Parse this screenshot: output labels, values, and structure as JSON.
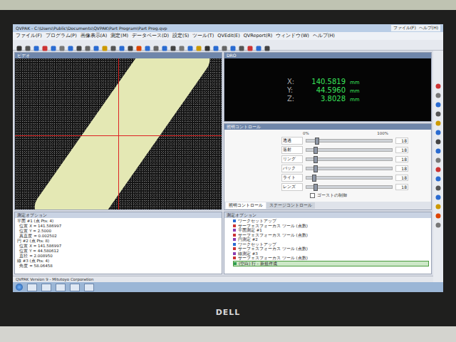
{
  "window": {
    "title": "QVPAK - C:\\Users\\Public\\Documents\\QVPAK\\Part Program\\Part Prog.qvp"
  },
  "menu": [
    "ファイル(F)",
    "プログラム(P)",
    "画像表示(A)",
    "測定(M)",
    "データベース(D)",
    "設定(S)",
    "ツール(T)",
    "QVEdit(E)",
    "QVReport(R)",
    "ウィンドウ(W)",
    "ヘルプ(H)"
  ],
  "mini_menu": [
    "ファイル(F)",
    "ヘルプ(H)"
  ],
  "video": {
    "title": "ビデオ"
  },
  "dro": {
    "title": "DRO",
    "axes": [
      {
        "label": "X:",
        "value": "140.5819",
        "unit": "mm"
      },
      {
        "label": "Y:",
        "value": "44.5960",
        "unit": "mm"
      },
      {
        "label": "Z:",
        "value": "3.8028",
        "unit": "mm"
      }
    ]
  },
  "lighting": {
    "title": "照明コントロール",
    "scale_min": "0%",
    "scale_max": "100%",
    "channels": [
      {
        "name": "透過",
        "level": 0.12,
        "reading": "18"
      },
      {
        "name": "落射",
        "level": 0.1,
        "reading": "18"
      },
      {
        "name": "リング",
        "level": 0.1,
        "reading": "18"
      },
      {
        "name": "バック",
        "level": 0.1,
        "reading": "18"
      },
      {
        "name": "ライト",
        "level": 0.08,
        "reading": "18"
      },
      {
        "name": "レンズ",
        "level": 0.1,
        "reading": "18"
      }
    ],
    "checkbox": {
      "label": "ゴーストの制御",
      "checked": false
    },
    "tabs": [
      {
        "label": "照明コントロール",
        "selected": true
      },
      {
        "label": "ステージコントロール",
        "selected": false
      }
    ]
  },
  "results": {
    "title": "測定オプション",
    "lines": [
      "平面 #1 (点 Pts: 4)",
      "  位置 X = 141.586997",
      "  位置 Y = 2.5000",
      "  真直度 = 0.002502",
      "円 #2 (点 Pts: 8)",
      "  位置 X = 141.586997",
      "  位置 Y = 44.580612",
      "  直径 = 2.008950",
      "線 #3 (点 Pts: 4)",
      "  角度 = 58.06458"
    ]
  },
  "program": {
    "title": "測定オプション",
    "items": [
      {
        "text": "ワークセットアップ",
        "kind": "setup",
        "selected": false
      },
      {
        "text": "サーフェスフォーカス ツール (点数)",
        "kind": "tool",
        "selected": false
      },
      {
        "text": "平面測定 #1",
        "kind": "measure",
        "selected": false
      },
      {
        "text": "サーフェスフォーカス ツール (点数)",
        "kind": "tool",
        "selected": false
      },
      {
        "text": "円測定 #2",
        "kind": "measure",
        "selected": false
      },
      {
        "text": "ワークセットアップ",
        "kind": "setup",
        "selected": false
      },
      {
        "text": "サーフェスフォーカス ツール (点数)",
        "kind": "tool",
        "selected": false
      },
      {
        "text": "線測定 #3",
        "kind": "measure",
        "selected": false
      },
      {
        "text": "サーフェスフォーカス ツール (点数)",
        "kind": "tool",
        "selected": false
      },
      {
        "text": "(空白) 行 - 新規作成",
        "kind": "new",
        "selected": true
      }
    ]
  },
  "status": {
    "text": "QVPAK Version 9 - Mitutoyo Corporation"
  },
  "monitor": {
    "brand": "DELL"
  }
}
